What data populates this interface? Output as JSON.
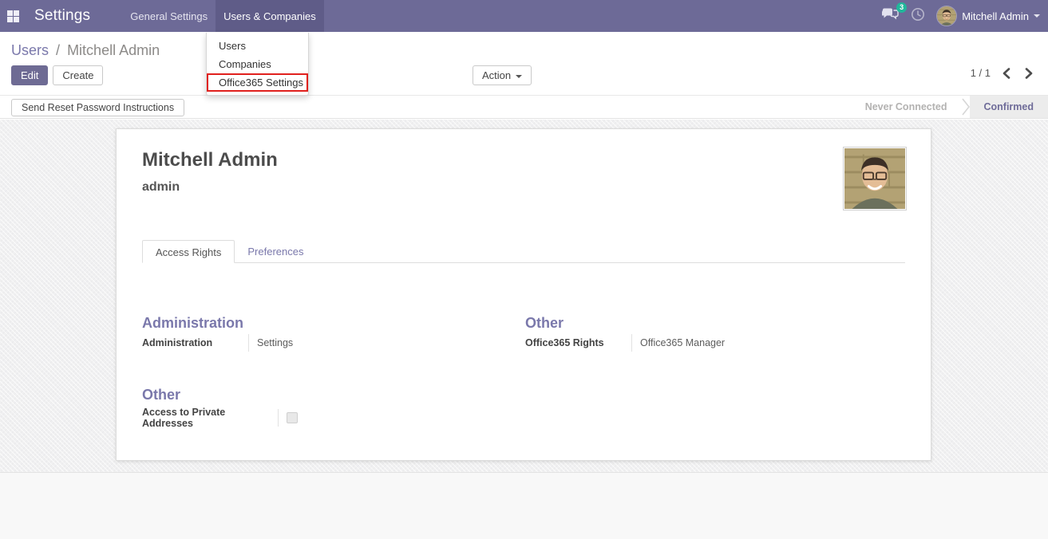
{
  "colors": {
    "navbar_bg": "#6d6a97",
    "navbar_active_bg": "#5f5c88",
    "accent_purple": "#7a78ab",
    "primary_button": "#6e6b94",
    "badge_green": "#21b79b",
    "highlight_red": "#e0201d",
    "status_active_bg": "#ececec"
  },
  "icons": {
    "apps": "apps-grid-icon (2x2 squares)",
    "messages": "chat-bubbles-icon",
    "activities": "clock-icon",
    "user_caret": "caret-down-icon",
    "pager_prev": "chevron-left-icon",
    "pager_next": "chevron-right-icon"
  },
  "navbar": {
    "brand": "Settings",
    "menu_general": "General Settings",
    "menu_users_companies": "Users & Companies",
    "messages_badge": "3",
    "user_name": "Mitchell Admin"
  },
  "dropdown": {
    "item_users": "Users",
    "item_companies": "Companies",
    "item_office365": "Office365 Settings"
  },
  "control_panel": {
    "breadcrumb_parent": "Users",
    "breadcrumb_separator": "/",
    "breadcrumb_current": "Mitchell Admin",
    "edit_label": "Edit",
    "create_label": "Create",
    "action_label": "Action",
    "pager_value": "1 / 1"
  },
  "statusbar": {
    "send_reset_label": "Send Reset Password Instructions",
    "state_never_connected": "Never Connected",
    "state_confirmed": "Confirmed"
  },
  "sheet": {
    "title": "Mitchell Admin",
    "login": "admin",
    "tab_access_rights": "Access Rights",
    "tab_preferences": "Preferences",
    "section_administration": {
      "heading": "Administration",
      "field_label": "Administration",
      "field_value": "Settings"
    },
    "section_other_right": {
      "heading": "Other",
      "field_label": "Office365 Rights",
      "field_value": "Office365 Manager"
    },
    "section_other_left": {
      "heading": "Other",
      "field_label": "Access to Private Addresses"
    }
  }
}
